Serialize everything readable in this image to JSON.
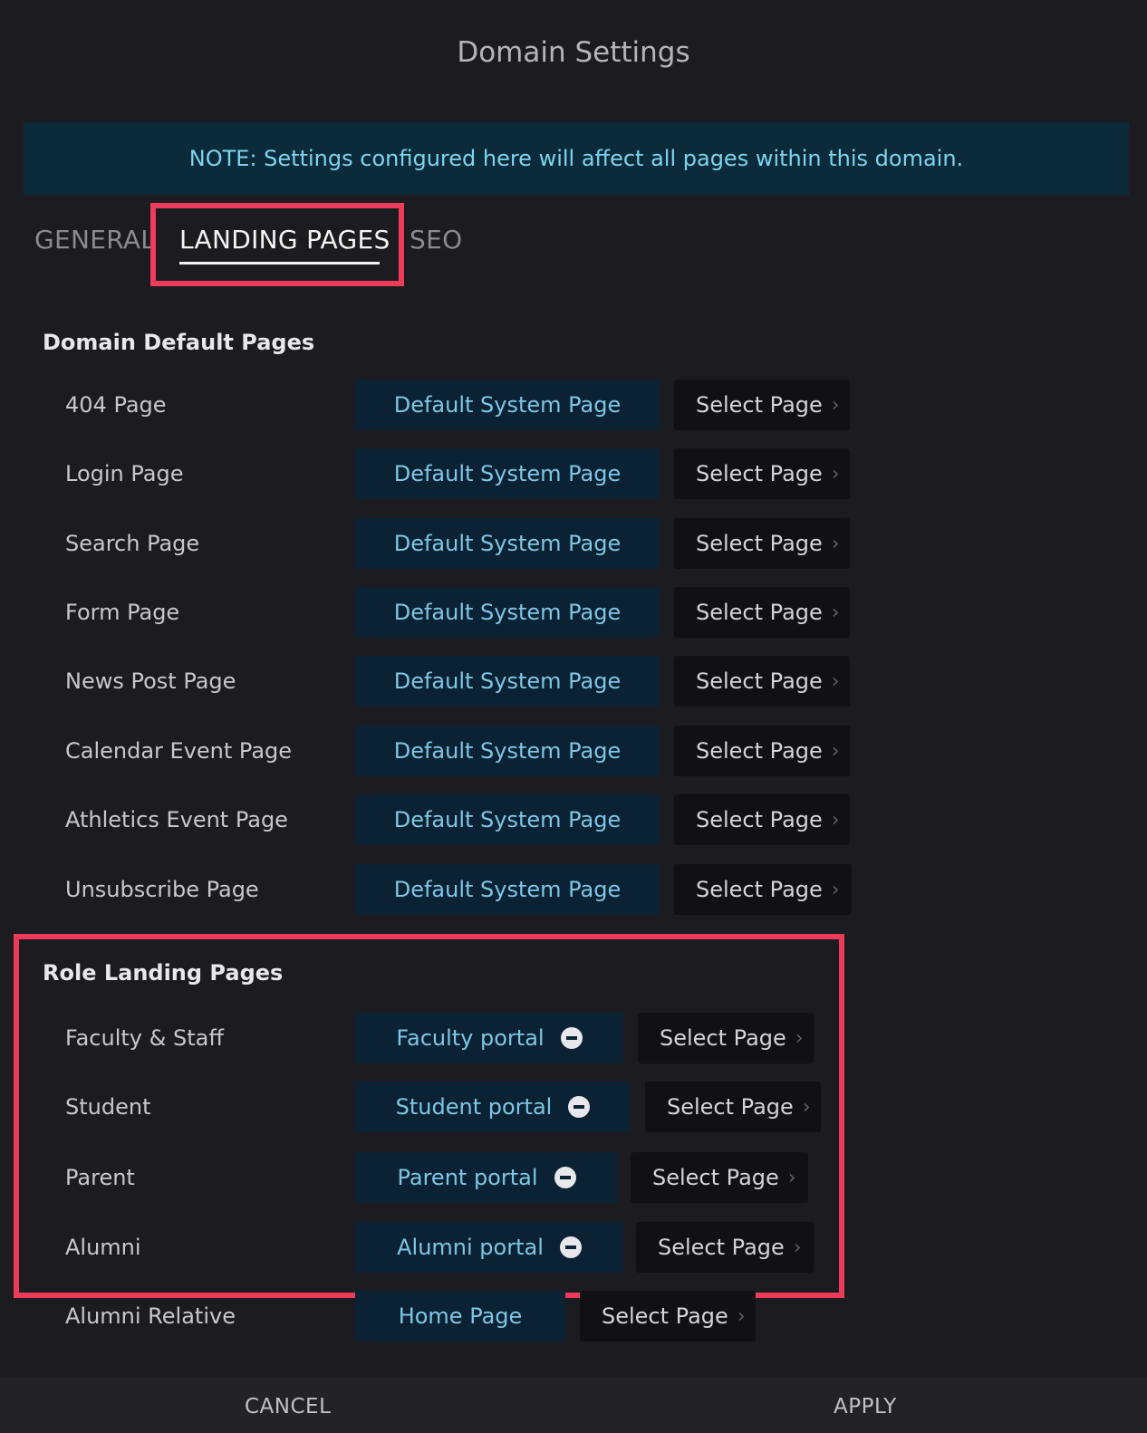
{
  "header": {
    "title": "Domain Settings"
  },
  "note": "NOTE: Settings configured here will affect all pages within this domain.",
  "tabs": [
    "GENERAL",
    "LANDING PAGES",
    "SEO"
  ],
  "sections": {
    "default": "Domain Default Pages",
    "role": "Role Landing Pages"
  },
  "default_pages": [
    {
      "label": "404 Page",
      "value": "Default System Page",
      "action": "Select Page"
    },
    {
      "label": "Login Page",
      "value": "Default System Page",
      "action": "Select Page"
    },
    {
      "label": "Search Page",
      "value": "Default System Page",
      "action": "Select Page"
    },
    {
      "label": "Form Page",
      "value": "Default System Page",
      "action": "Select Page"
    },
    {
      "label": "News Post Page",
      "value": "Default System Page",
      "action": "Select Page"
    },
    {
      "label": "Calendar Event Page",
      "value": "Default System Page",
      "action": "Select Page"
    },
    {
      "label": "Athletics Event Page",
      "value": "Default System Page",
      "action": "Select Page"
    },
    {
      "label": "Unsubscribe Page",
      "value": "Default System Page",
      "action": "Select Page"
    }
  ],
  "role_pages": [
    {
      "label": "Faculty & Staff",
      "value": "Faculty portal",
      "action": "Select Page"
    },
    {
      "label": "Student",
      "value": "Student portal",
      "action": "Select Page"
    },
    {
      "label": "Parent",
      "value": "Parent portal",
      "action": "Select Page"
    },
    {
      "label": "Alumni",
      "value": "Alumni portal",
      "action": "Select Page"
    },
    {
      "label": "Alumni Relative",
      "value": "Home Page",
      "action": "Select Page"
    }
  ],
  "footer": {
    "cancel": "CANCEL",
    "apply": "APPLY"
  },
  "colors": {
    "highlight": "#ef3b5a",
    "accent": "#7fc6e4",
    "note_text": "#7fd3ee"
  }
}
